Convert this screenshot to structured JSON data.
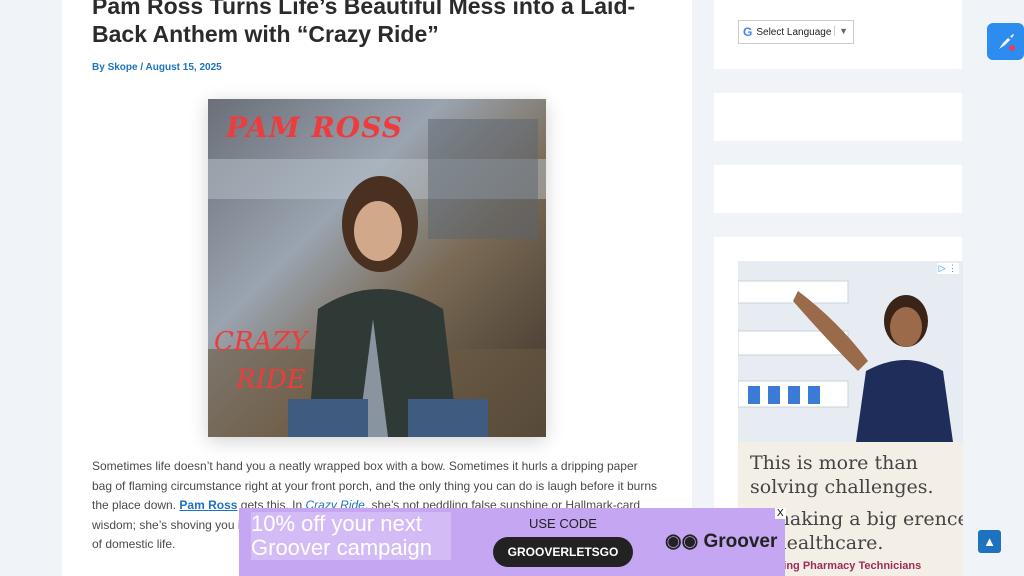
{
  "article": {
    "title": "Pam Ross Turns Life’s Beautiful Mess into a Laid-Back Anthem with “Crazy Ride”",
    "byline_prefix": "By ",
    "author": "Skope",
    "separator": " / ",
    "date": "August 15, 2025",
    "cover": {
      "artist": "PAM ROSS",
      "title_line1": "CRAZY",
      "title_line2": "RIDE"
    },
    "p1_a": "Sometimes life doesn’t hand you a neatly wrapped box with a bow. Sometimes it hurls a dripping paper bag of flaming circumstance right at your front porch, and the only thing you can do is laugh before it burns the place down. ",
    "p1_link": "Pam Ross",
    "p1_b": " gets this. In ",
    "p1_em": "Crazy Ride",
    "p1_c": ", she’s not peddling false sunshine or Hallmark-card wisdom; she’s shoving you into the pa",
    "p1_d": "of domestic life."
  },
  "sidebar": {
    "translate_label": "Select Language",
    "ad": {
      "line1": "This is more than solving challenges.",
      "line2": "is making a big erence in healthcare.",
      "footer": "Hiring Pharmacy Technicians"
    }
  },
  "banner": {
    "headline": "10% off your next Groover campaign",
    "code_label": "USE CODE",
    "code": "GROOVERLETSGO",
    "brand": "Groover",
    "close": "X"
  },
  "colors": {
    "link": "#1e73be",
    "banner": "#c5a6f2",
    "cover_text": "#ef3b3b"
  }
}
